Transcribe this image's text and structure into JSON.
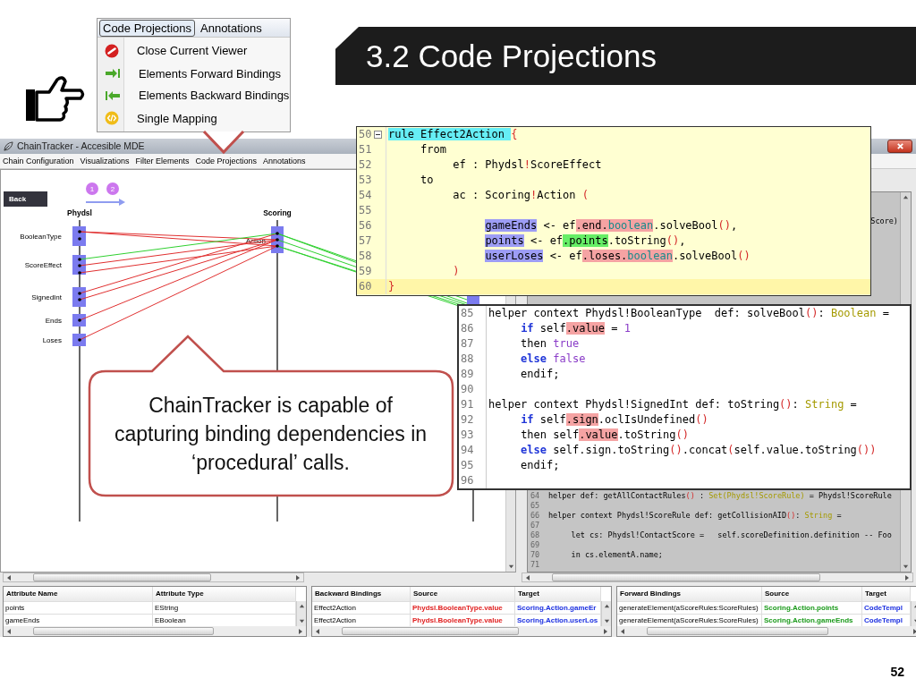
{
  "slide": {
    "title": "3.2 Code Projections",
    "page_number": "52"
  },
  "menu_popup": {
    "menus": [
      {
        "label": "Code Projections",
        "selected": true
      },
      {
        "label": "Annotations",
        "selected": false
      }
    ],
    "items": [
      {
        "label": "Close Current Viewer",
        "kind": "close"
      },
      {
        "label": "Elements Forward Bindings",
        "kind": "forward"
      },
      {
        "label": "Elements Backward Bindings",
        "kind": "backward"
      },
      {
        "label": "Single Mapping",
        "kind": "mapping"
      }
    ]
  },
  "window": {
    "title": "ChainTracker - Accesible MDE"
  },
  "menu_bar": [
    "Chain Configuration",
    "Visualizations",
    "Filter Elements",
    "Code Projections",
    "Annotations"
  ],
  "diagram": {
    "back_button": "Back",
    "steps": [
      "1",
      "2"
    ],
    "models": [
      {
        "name": "Phydsl",
        "elements": [
          "BooleanType",
          "ScoreEffect",
          "SignedInt",
          "Ends",
          "Loses"
        ]
      },
      {
        "name": "Scoring",
        "elements": [
          "Action"
        ]
      }
    ]
  },
  "editor": {
    "fragment": "Score)",
    "lines": [
      {
        "number": "64",
        "tokens": [
          {
            "text": "helper def: getAllContactRules",
            "kind": "plain"
          },
          {
            "text": "()",
            "kind": "punct"
          },
          {
            "text": " : ",
            "kind": "plain"
          },
          {
            "text": "Set(Phydsl!ScoreRule)",
            "kind": "type"
          },
          {
            "text": " = Phydsl!ScoreRule",
            "kind": "plain"
          }
        ]
      },
      {
        "number": "65"
      },
      {
        "number": "66",
        "tokens": [
          {
            "text": "helper context Phydsl!ScoreRule def: getCollisionAID",
            "kind": "plain"
          },
          {
            "text": "()",
            "kind": "punct"
          },
          {
            "text": ": ",
            "kind": "plain"
          },
          {
            "text": "String",
            "kind": "type"
          },
          {
            "text": " =",
            "kind": "plain"
          }
        ]
      },
      {
        "number": "67"
      },
      {
        "number": "68",
        "tokens": [
          {
            "text": "     let cs: Phydsl!ContactScore =   self.scoreDefinition.definition -- Foo",
            "kind": "plain"
          }
        ]
      },
      {
        "number": "69"
      },
      {
        "number": "70",
        "tokens": [
          {
            "text": "     in cs.elementA.name;",
            "kind": "plain"
          }
        ]
      },
      {
        "number": "71"
      }
    ]
  },
  "rule_popup": {
    "lines": [
      {
        "number": "50",
        "fold": true,
        "current": false,
        "tokens": [
          {
            "text": "rule Effect2Action ",
            "kind": "plain",
            "color": "#66eef5"
          },
          {
            "text": "{",
            "kind": "punct"
          }
        ]
      },
      {
        "number": "51",
        "fold": false,
        "current": false,
        "tokens": [
          {
            "text": "     from",
            "kind": "plain"
          }
        ]
      },
      {
        "number": "52",
        "fold": false,
        "current": false,
        "tokens": [
          {
            "text": "          ef : Phydsl",
            "kind": "plain"
          },
          {
            "text": "!",
            "kind": "punct"
          },
          {
            "text": "ScoreEffect",
            "kind": "plain"
          }
        ]
      },
      {
        "number": "53",
        "fold": false,
        "current": false,
        "tokens": [
          {
            "text": "     to",
            "kind": "plain"
          }
        ]
      },
      {
        "number": "54",
        "fold": false,
        "current": false,
        "tokens": [
          {
            "text": "          ac : Scoring",
            "kind": "plain"
          },
          {
            "text": "!",
            "kind": "punct"
          },
          {
            "text": "Action ",
            "kind": "plain"
          },
          {
            "text": "(",
            "kind": "punct"
          }
        ]
      },
      {
        "number": "55",
        "fold": false,
        "current": false
      },
      {
        "number": "56",
        "fold": false,
        "current": false,
        "tokens": [
          {
            "text": "               gameEnds",
            "kind": "plain",
            "color": "#9d9df5"
          },
          {
            "text": " <- ef",
            "kind": "plain"
          },
          {
            "text": ".end.",
            "kind": "plain",
            "color": "#f5a3a3"
          },
          {
            "text": "boolean",
            "kind": "attr",
            "color": "#f5a3a3"
          },
          {
            "text": ".solveBool",
            "kind": "plain"
          },
          {
            "text": "()",
            "kind": "punct"
          },
          {
            "text": ",",
            "kind": "plain"
          }
        ]
      },
      {
        "number": "57",
        "fold": false,
        "current": false,
        "tokens": [
          {
            "text": "               points",
            "kind": "plain",
            "color": "#9d9df5"
          },
          {
            "text": " <- ef",
            "kind": "plain"
          },
          {
            "text": ".points",
            "kind": "plain",
            "color": "#66ee66"
          },
          {
            "text": ".toString",
            "kind": "plain"
          },
          {
            "text": "()",
            "kind": "punct"
          },
          {
            "text": ",",
            "kind": "plain"
          }
        ]
      },
      {
        "number": "58",
        "fold": false,
        "current": false,
        "tokens": [
          {
            "text": "               userLoses",
            "kind": "plain",
            "color": "#9d9df5"
          },
          {
            "text": " <- ef",
            "kind": "plain"
          },
          {
            "text": ".loses.",
            "kind": "plain",
            "color": "#f5a3a3"
          },
          {
            "text": "boolean",
            "kind": "attr",
            "color": "#f5a3a3"
          },
          {
            "text": ".solveBool",
            "kind": "plain"
          },
          {
            "text": "()",
            "kind": "punct"
          }
        ]
      },
      {
        "number": "59",
        "fold": false,
        "current": false,
        "tokens": [
          {
            "text": "          )",
            "kind": "punct"
          }
        ]
      },
      {
        "number": "60",
        "fold": false,
        "current": true,
        "tokens": [
          {
            "text": "}",
            "kind": "punct"
          }
        ]
      }
    ]
  },
  "helper_popup": {
    "lines": [
      {
        "number": "85",
        "tokens": [
          {
            "text": "helper context Phydsl!BooleanType  def: solveBool",
            "kind": "plain"
          },
          {
            "text": "()",
            "kind": "punct"
          },
          {
            "text": ": ",
            "kind": "plain"
          },
          {
            "text": "Boolean",
            "kind": "type"
          },
          {
            "text": " =",
            "kind": "plain"
          }
        ]
      },
      {
        "number": "86",
        "tokens": [
          {
            "text": "     if",
            "kind": "keyword"
          },
          {
            "text": " self",
            "kind": "plain"
          },
          {
            "text": ".value",
            "kind": "plain",
            "color": "#f5a3a3"
          },
          {
            "text": " = ",
            "kind": "plain"
          },
          {
            "text": "1",
            "kind": "literal"
          }
        ]
      },
      {
        "number": "87",
        "tokens": [
          {
            "text": "     then ",
            "kind": "plain"
          },
          {
            "text": "true",
            "kind": "literal"
          }
        ]
      },
      {
        "number": "88",
        "tokens": [
          {
            "text": "     else",
            "kind": "keyword"
          },
          {
            "text": " false",
            "kind": "literal"
          }
        ]
      },
      {
        "number": "89",
        "tokens": [
          {
            "text": "     endif;",
            "kind": "plain"
          }
        ]
      },
      {
        "number": "90"
      },
      {
        "number": "91",
        "tokens": [
          {
            "text": "helper context Phydsl!SignedInt def: toString",
            "kind": "plain"
          },
          {
            "text": "()",
            "kind": "punct"
          },
          {
            "text": ": ",
            "kind": "plain"
          },
          {
            "text": "String",
            "kind": "type"
          },
          {
            "text": " =",
            "kind": "plain"
          }
        ]
      },
      {
        "number": "92",
        "tokens": [
          {
            "text": "     if",
            "kind": "keyword"
          },
          {
            "text": " self",
            "kind": "plain"
          },
          {
            "text": ".sign",
            "kind": "plain",
            "color": "#f5a3a3"
          },
          {
            "text": ".oclIsUndefined",
            "kind": "plain"
          },
          {
            "text": "()",
            "kind": "punct"
          }
        ]
      },
      {
        "number": "93",
        "tokens": [
          {
            "text": "     then self",
            "kind": "plain"
          },
          {
            "text": ".value",
            "kind": "plain",
            "color": "#f5a3a3"
          },
          {
            "text": ".toString",
            "kind": "plain"
          },
          {
            "text": "()",
            "kind": "punct"
          }
        ]
      },
      {
        "number": "94",
        "tokens": [
          {
            "text": "     else",
            "kind": "keyword"
          },
          {
            "text": " self.sign.toString",
            "kind": "plain"
          },
          {
            "text": "()",
            "kind": "punct"
          },
          {
            "text": ".concat",
            "kind": "plain"
          },
          {
            "text": "(",
            "kind": "punct"
          },
          {
            "text": "self.value.toString",
            "kind": "plain"
          },
          {
            "text": "())",
            "kind": "punct"
          }
        ]
      },
      {
        "number": "95",
        "tokens": [
          {
            "text": "     endif;",
            "kind": "plain"
          }
        ]
      },
      {
        "number": "96"
      }
    ]
  },
  "callout": {
    "text": "ChainTracker is capable of capturing binding dependencies in ‘procedural’ calls."
  },
  "tables": [
    {
      "columns": [
        {
          "label": "Attribute Name"
        },
        {
          "label": "Attribute Type"
        }
      ],
      "rows": [
        [
          "points",
          "EString"
        ],
        [
          "gameEnds",
          "EBoolean"
        ]
      ]
    },
    {
      "columns": [
        {
          "label": "Backward Bindings"
        },
        {
          "label": "Source",
          "color": "#e02020"
        },
        {
          "label": "Target",
          "color": "#1a2ee0"
        }
      ],
      "rows": [
        [
          "Effect2Action",
          "Phydsl.BooleanType.value",
          "Scoring.Action.gameEr"
        ],
        [
          "Effect2Action",
          "Phydsl.BooleanType.value",
          "Scoring.Action.userLos"
        ]
      ]
    },
    {
      "columns": [
        {
          "label": "Forward Bindings"
        },
        {
          "label": "Source",
          "color": "#1a9a1a"
        },
        {
          "label": "Target",
          "color": "#1a2ee0"
        }
      ],
      "rows": [
        [
          "generateElement(aScoreRules:ScoreRules)",
          "Scoring.Action.points",
          "CodeTempl"
        ],
        [
          "generateElement(aScoreRules:ScoreRules)",
          "Scoring.Action.gameEnds",
          "CodeTempl"
        ]
      ]
    }
  ]
}
